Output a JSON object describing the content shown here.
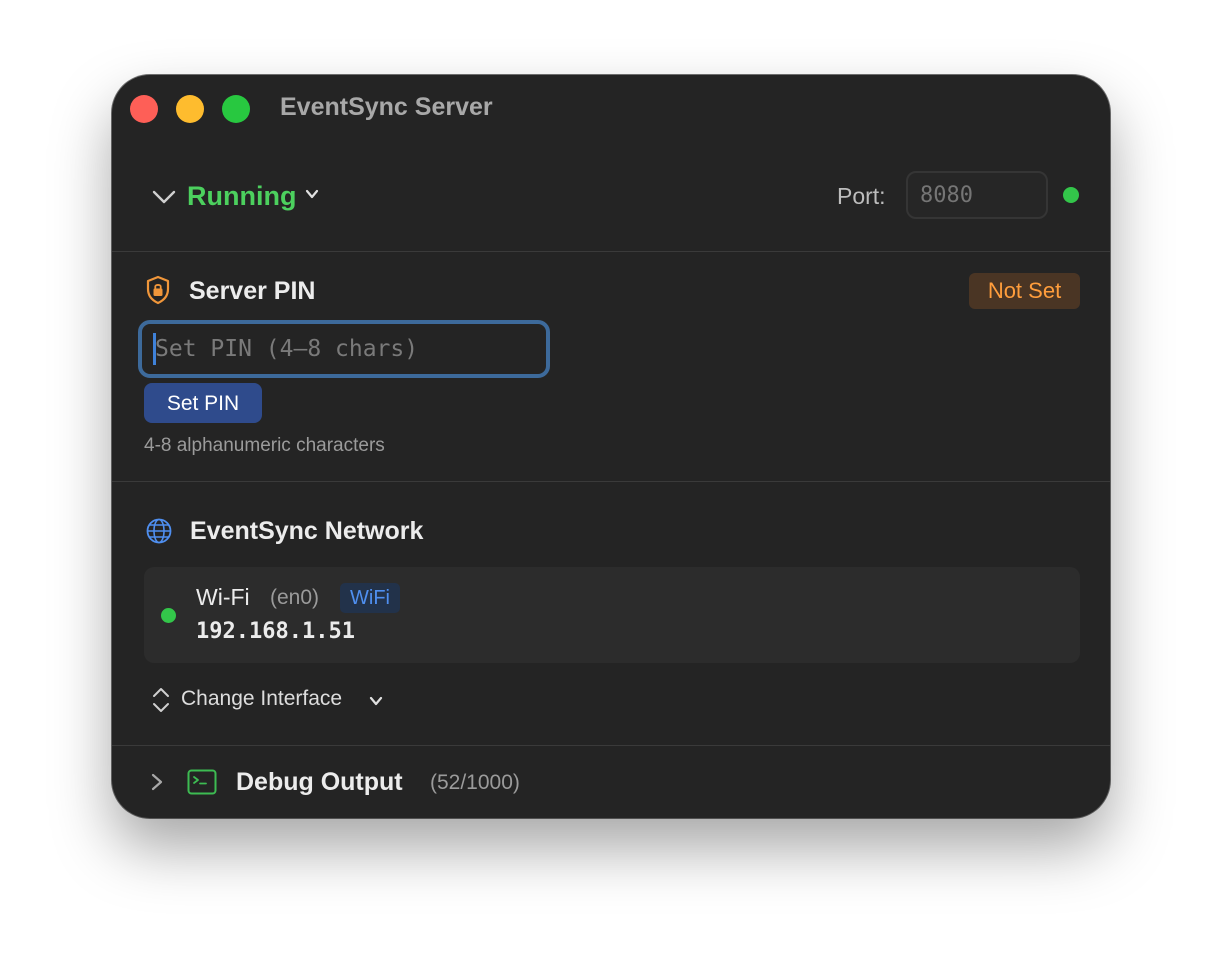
{
  "window": {
    "title": "EventSync Server"
  },
  "status": {
    "state_label": "Running",
    "port_label": "Port:",
    "port_placeholder": "8080",
    "indicator_color": "#33c64a",
    "accent_green": "#4cd05e"
  },
  "pin": {
    "title": "Server PIN",
    "badge": "Not Set",
    "input_placeholder": "Set PIN (4–8 chars)",
    "button": "Set PIN",
    "hint": "4-8 alphanumeric characters",
    "icon": "lock-shield-icon"
  },
  "network": {
    "title": "EventSync Network",
    "icon": "globe-icon",
    "interface": {
      "name": "Wi-Fi",
      "device": "(en0)",
      "type_badge": "WiFi",
      "ip": "192.168.1.51"
    },
    "change_label": "Change Interface"
  },
  "debug": {
    "title": "Debug Output",
    "count": "(52/1000)",
    "icon": "terminal-icon"
  }
}
